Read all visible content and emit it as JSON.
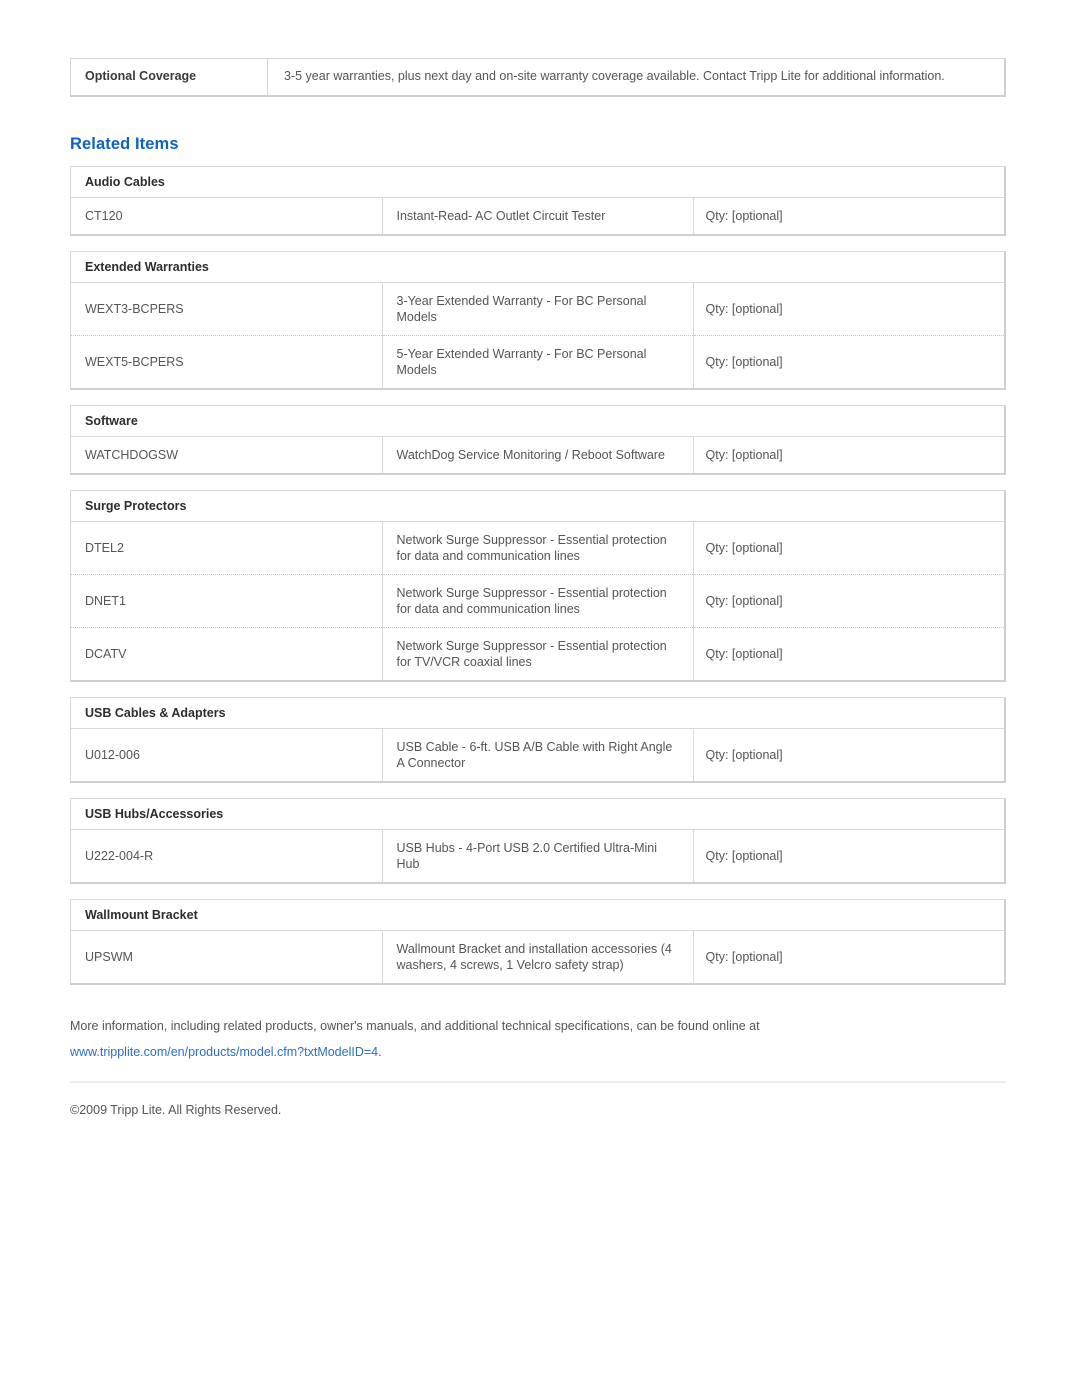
{
  "spec_row": {
    "label": "Optional Coverage",
    "value": "3-5 year warranties, plus next day and on-site warranty coverage available. Contact Tripp Lite for additional information."
  },
  "related_items": {
    "heading": "Related Items",
    "heading_color": "#1062c4",
    "groups": [
      {
        "title": "Audio Cables",
        "rows": [
          {
            "model": "CT120",
            "description": "Instant-Read- AC Outlet Circuit Tester",
            "qty": "Qty: [optional]"
          }
        ]
      },
      {
        "title": "Extended Warranties",
        "rows": [
          {
            "model": "WEXT3-BCPERS",
            "description": "3-Year Extended Warranty - For BC Personal Models",
            "qty": "Qty: [optional]"
          },
          {
            "model": "WEXT5-BCPERS",
            "description": "5-Year Extended Warranty - For BC Personal Models",
            "qty": "Qty: [optional]"
          }
        ]
      },
      {
        "title": "Software",
        "rows": [
          {
            "model": "WATCHDOGSW",
            "description": "WatchDog Service Monitoring / Reboot Software",
            "qty": "Qty: [optional]"
          }
        ]
      },
      {
        "title": "Surge Protectors",
        "rows": [
          {
            "model": "DTEL2",
            "description": "Network Surge Suppressor - Essential protection for data and communication lines",
            "qty": "Qty: [optional]"
          },
          {
            "model": "DNET1",
            "description": "Network Surge Suppressor - Essential protection for data and communication lines",
            "qty": "Qty: [optional]"
          },
          {
            "model": "DCATV",
            "description": "Network Surge Suppressor - Essential protection for TV/VCR coaxial lines",
            "qty": "Qty: [optional]"
          }
        ]
      },
      {
        "title": "USB Cables & Adapters",
        "rows": [
          {
            "model": "U012-006",
            "description": "USB Cable - 6-ft. USB A/B Cable with Right Angle A Connector",
            "qty": "Qty: [optional]"
          }
        ]
      },
      {
        "title": "USB Hubs/Accessories",
        "rows": [
          {
            "model": "U222-004-R",
            "description": "USB Hubs - 4-Port USB 2.0 Certified Ultra-Mini Hub",
            "qty": "Qty: [optional]"
          }
        ]
      },
      {
        "title": "Wallmount Bracket",
        "rows": [
          {
            "model": "UPSWM",
            "description": "Wallmount Bracket and installation accessories (4 washers, 4 screws, 1 Velcro safety strap)",
            "qty": "Qty: [optional]"
          }
        ]
      }
    ]
  },
  "footer": {
    "note_text": "More information, including related products, owner's manuals, and additional technical specifications, can be found online at ",
    "link_text": "www.tripplite.com/en/products/model.cfm?txtModelID=4",
    "link_suffix": ".",
    "link_color": "#2a6fd0",
    "copyright": "©2009 Tripp Lite.  All Rights Reserved."
  }
}
